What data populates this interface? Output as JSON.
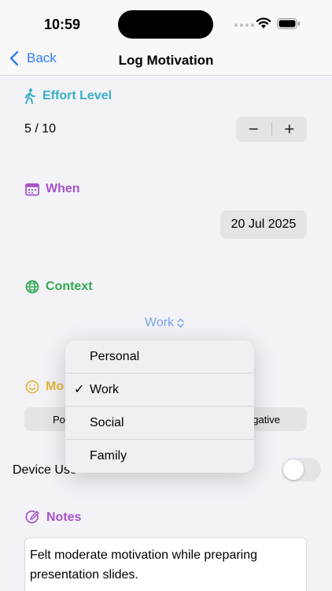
{
  "status_bar": {
    "time": "10:59"
  },
  "nav": {
    "back_label": "Back",
    "title": "Log Motivation"
  },
  "effort": {
    "header": "Effort Level",
    "value": "5 / 10",
    "decrement": "−",
    "increment": "+",
    "icon": "walking-person-icon",
    "color": "#3aafc3"
  },
  "when": {
    "header": "When",
    "date": "20 Jul 2025",
    "icon": "calendar-icon",
    "color": "#a652c8"
  },
  "context": {
    "header": "Context",
    "selected": "Work",
    "icon": "globe-icon",
    "color": "#34a853",
    "options": [
      {
        "label": "Personal",
        "checked": false
      },
      {
        "label": "Work",
        "checked": true
      },
      {
        "label": "Social",
        "checked": false
      },
      {
        "label": "Family",
        "checked": false
      }
    ]
  },
  "mood": {
    "header_partial": "Mo",
    "segment_left_partial": "Po",
    "segment_right_partial": "gative",
    "icon": "smiley-icon",
    "color": "#e3b53a"
  },
  "device": {
    "label_partial": "Device Use",
    "toggle_on": false
  },
  "notes": {
    "header": "Notes",
    "text_line1": "Felt moderate motivation while preparing",
    "text_line2": "presentation slides.",
    "icon": "pencil-circle-icon",
    "color": "#a652c8"
  },
  "accent_color": "#2f7cf6"
}
